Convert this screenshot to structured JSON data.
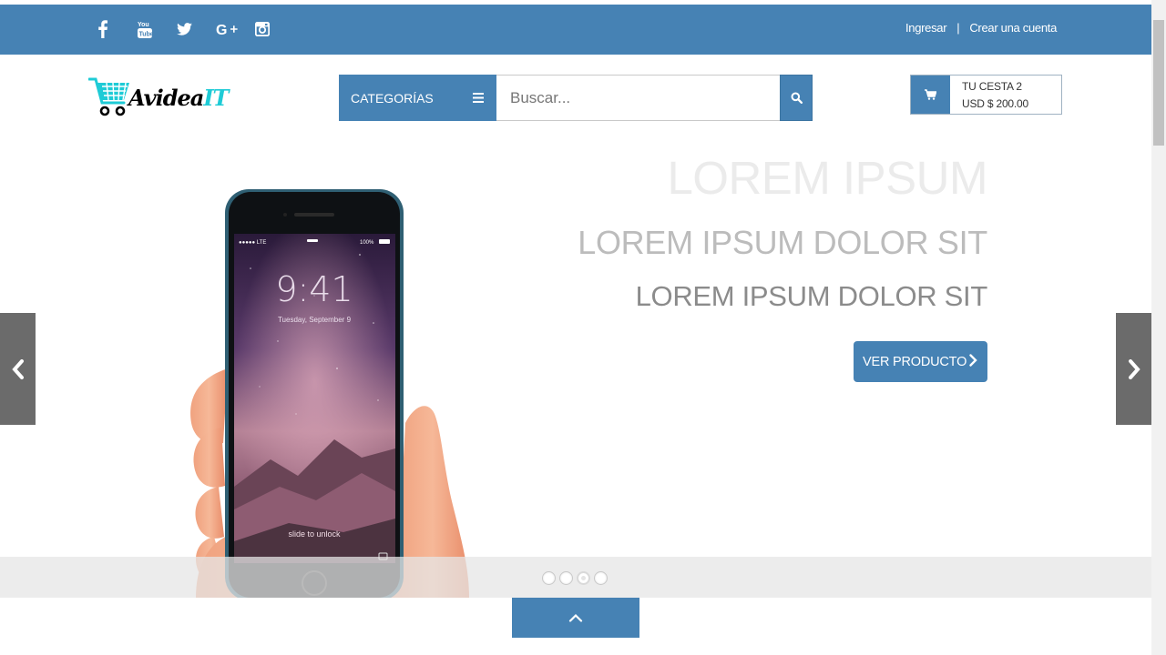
{
  "social": {
    "icons": [
      "facebook-icon",
      "youtube-icon",
      "twitter-icon",
      "google-plus-icon",
      "instagram-icon"
    ]
  },
  "account": {
    "login": "Ingresar",
    "separator": "|",
    "register": "Crear una cuenta"
  },
  "header": {
    "logo": {
      "part1": "Avidea",
      "part2": "IT"
    },
    "categories_label": "CATEGORÍAS",
    "search_placeholder": "Buscar...",
    "cart": {
      "line1": "TU CESTA 2",
      "line2": "USD $ 200.00"
    }
  },
  "hero": {
    "title": "LOREM IPSUM",
    "subtitle": "LOREM IPSUM DOLOR SIT",
    "subtitle2": "LOREM IPSUM DOLOR SIT",
    "cta_label": "VER PRODUCTO",
    "phone_time": "9:41",
    "phone_date": "Tuesday, September 9",
    "phone_unlock": "slide to unlock",
    "phone_status_right": "100%",
    "phone_status_left": "LTE"
  },
  "slider": {
    "dot_count": 4,
    "active_index": 2
  },
  "colors": {
    "primary": "#4682b4",
    "logo_accent": "#1ecbd6",
    "arrow_bg": "#6b6b6b"
  }
}
